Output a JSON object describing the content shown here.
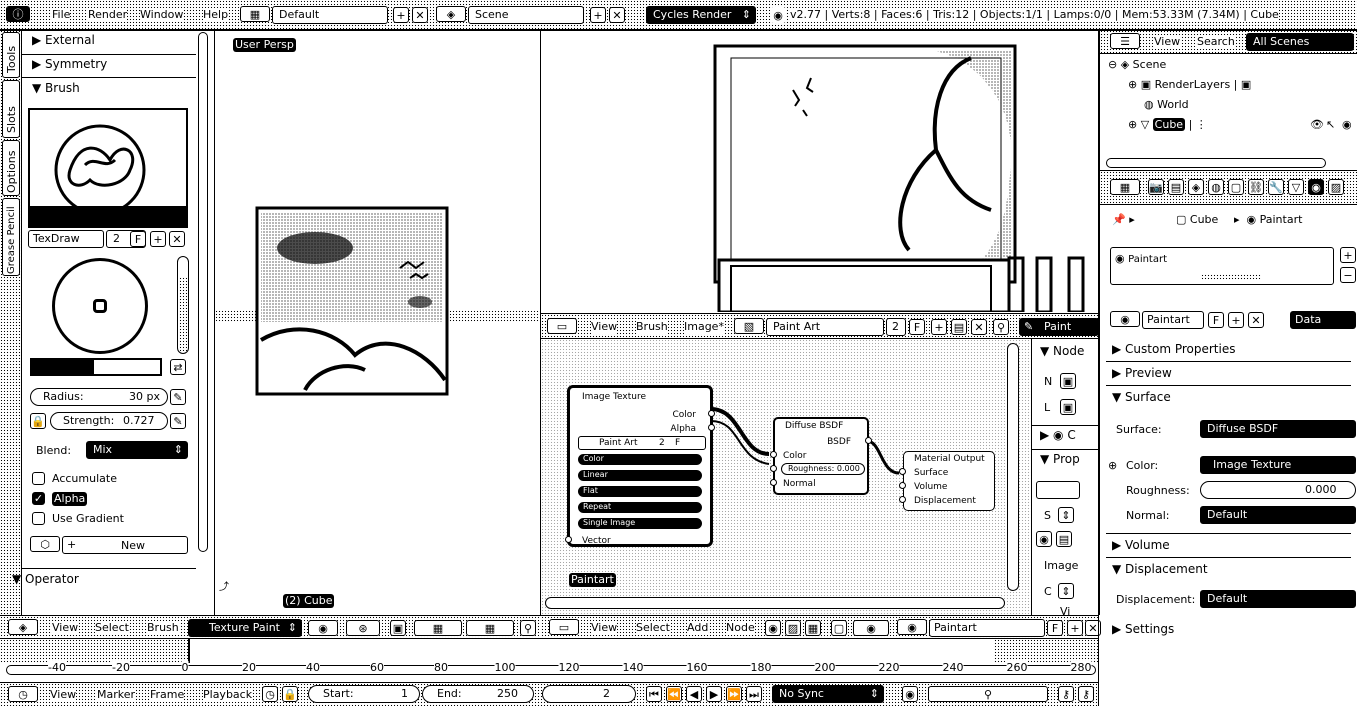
{
  "topbar": {
    "menus": [
      "File",
      "Render",
      "Window",
      "Help"
    ],
    "screen_layout": "Default",
    "scene": "Scene",
    "engine": "Cycles Render",
    "stats": "v2.77 | Verts:8 | Faces:6 | Tris:12 | Objects:1/1 | Lamps:0/0 | Mem:53.33M (7.34M) | Cube"
  },
  "left_tabs": [
    "Tools",
    "Slots",
    "Options",
    "Grease Pencil"
  ],
  "toolshelf": {
    "external": "External",
    "symmetry": "Symmetry",
    "brush": "Brush",
    "brush_name": "TexDraw",
    "brush_users": "2",
    "radius_label": "Radius:",
    "radius_value": "30 px",
    "strength_label": "Strength:",
    "strength_value": "0.727",
    "blend_label": "Blend:",
    "blend_value": "Mix",
    "accumulate": "Accumulate",
    "alpha": "Alpha",
    "use_gradient": "Use Gradient",
    "new": "New",
    "operator": "Operator"
  },
  "viewport3d": {
    "label": "User Persp",
    "object_label": "(2) Cube",
    "menus": [
      "View",
      "Select",
      "Brush"
    ],
    "mode": "Texture Paint"
  },
  "image_editor": {
    "menus": [
      "View",
      "Brush",
      "Image*"
    ],
    "image_name": "Paint Art",
    "users": "2",
    "fake": "F",
    "mode": "Paint"
  },
  "node_editor": {
    "menus": [
      "View",
      "Select",
      "Add",
      "Node"
    ],
    "material": "Paintart",
    "fake": "F",
    "material_label": "Paintart",
    "image_texture": {
      "title": "Image Texture",
      "out_color": "Color",
      "out_alpha": "Alpha",
      "image": "Paint Art",
      "users": "2",
      "fake": "F",
      "rows": [
        "Color",
        "Linear",
        "Flat",
        "Repeat",
        "Single Image"
      ],
      "in_vector": "Vector"
    },
    "diffuse": {
      "title": "Diffuse BSDF",
      "out": "BSDF",
      "in_color": "Color",
      "roughness": "Roughness: 0.000",
      "in_normal": "Normal"
    },
    "output": {
      "title": "Material Output",
      "surface": "Surface",
      "volume": "Volume",
      "displacement": "Displacement"
    },
    "sidebar": {
      "node": "Node",
      "n": "N",
      "l": "L",
      "c": "C",
      "prop": "Prop",
      "s": "S",
      "image": "Image",
      "c2": "C",
      "vi": "Vi"
    }
  },
  "outliner": {
    "menus": [
      "View",
      "Search"
    ],
    "filter": "All Scenes",
    "items": [
      "Scene",
      "RenderLayers",
      "World",
      "Cube"
    ]
  },
  "properties": {
    "breadcrumb_object": "Cube",
    "breadcrumb_material": "Paintart",
    "slot": "Paintart",
    "material_name": "Paintart",
    "fake": "F",
    "data": "Data",
    "custom_properties": "Custom Properties",
    "preview": "Preview",
    "surface_section": "Surface",
    "surface_label": "Surface:",
    "surface_value": "Diffuse BSDF",
    "color_label": "Color:",
    "color_value": "Image Texture",
    "roughness_label": "Roughness:",
    "roughness_value": "0.000",
    "normal_label": "Normal:",
    "normal_value": "Default",
    "volume_section": "Volume",
    "displacement_section": "Displacement",
    "displacement_label": "Displacement:",
    "displacement_value": "Default",
    "settings_section": "Settings"
  },
  "timeline": {
    "ticks": [
      "-40",
      "-20",
      "0",
      "20",
      "40",
      "60",
      "80",
      "100",
      "120",
      "140",
      "160",
      "180",
      "200",
      "220",
      "240",
      "260",
      "280"
    ],
    "menus": [
      "View",
      "Marker",
      "Frame",
      "Playback"
    ],
    "start_label": "Start:",
    "start_value": "1",
    "end_label": "End:",
    "end_value": "250",
    "current": "2",
    "sync": "No Sync"
  }
}
